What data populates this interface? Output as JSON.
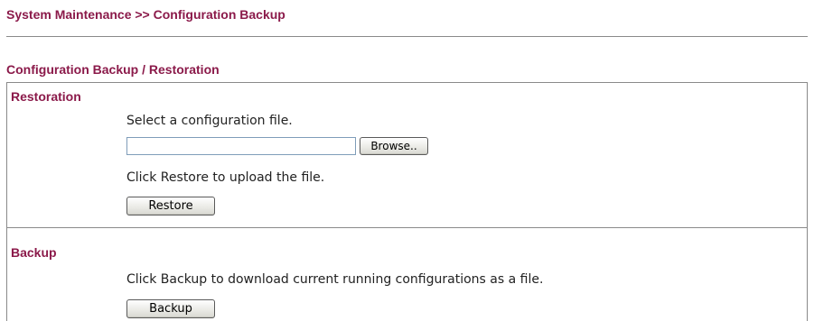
{
  "header": {
    "breadcrumb": "System Maintenance >> Configuration Backup"
  },
  "main": {
    "section_title": "Configuration Backup / Restoration",
    "restoration": {
      "heading": "Restoration",
      "select_prompt": "Select a configuration file.",
      "file_input_value": "",
      "browse_label": "Browse..",
      "restore_hint": "Click Restore to upload the file.",
      "restore_label": "Restore"
    },
    "backup": {
      "heading": "Backup",
      "backup_hint": "Click Backup to download current running configurations as a file.",
      "backup_label": "Backup"
    }
  },
  "colors": {
    "heading_text": "#8b1a4a",
    "rule_line": "#8a8a8a",
    "input_border": "#7f9db9"
  }
}
